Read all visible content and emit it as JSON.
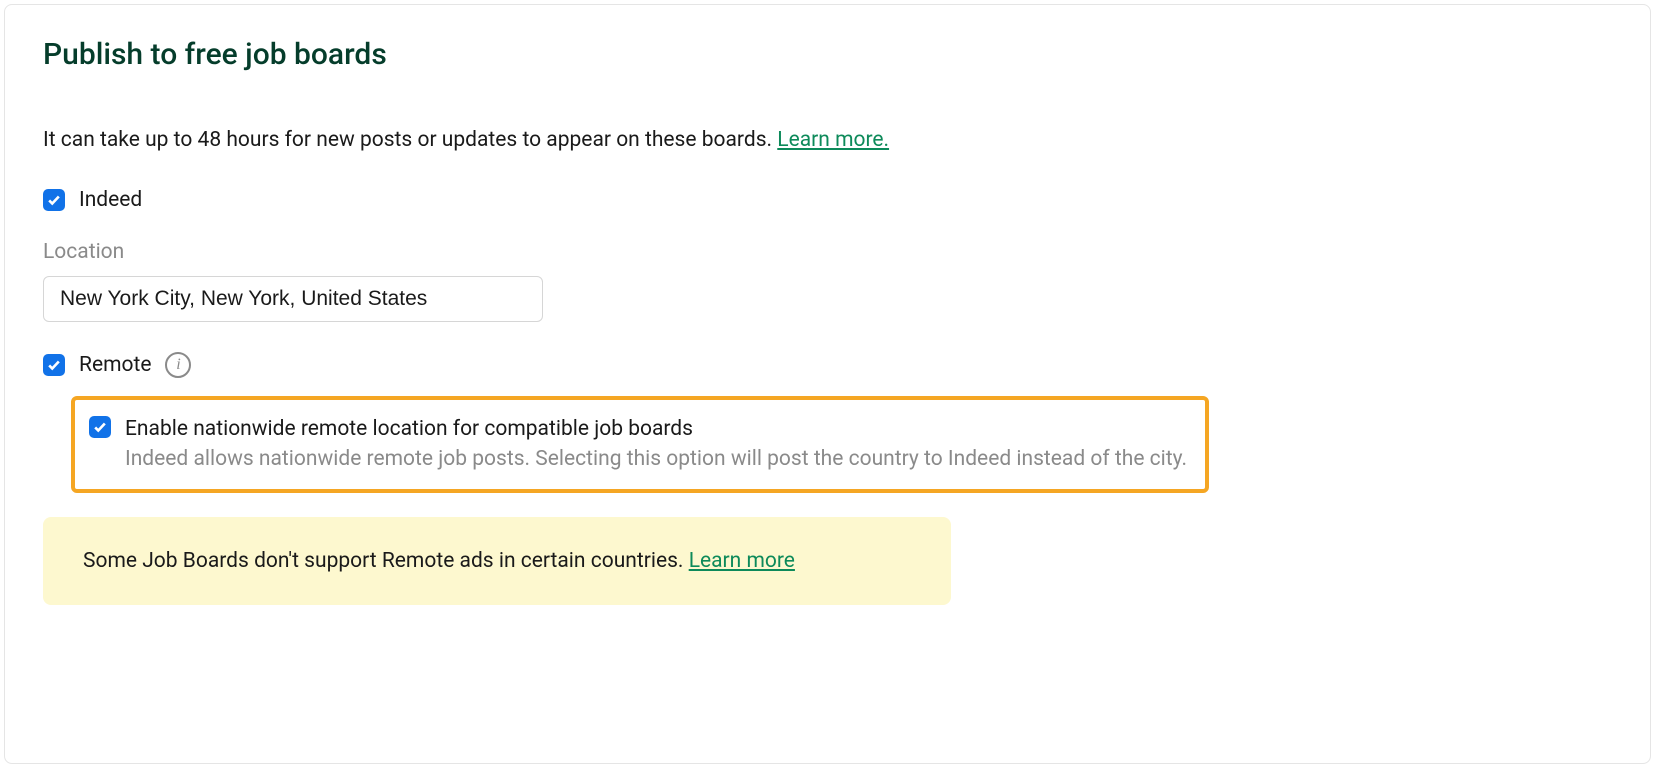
{
  "title": "Publish to free job boards",
  "intro_text": "It can take up to 48 hours for new posts or updates to appear on these boards.  ",
  "intro_link": "Learn more.",
  "indeed": {
    "label": "Indeed",
    "checked": true
  },
  "location": {
    "label": "Location",
    "value": "New York City, New York, United States"
  },
  "remote": {
    "label": "Remote",
    "checked": true
  },
  "nationwide": {
    "checked": true,
    "label": "Enable nationwide remote location for compatible job boards",
    "description": "Indeed allows nationwide remote job posts. Selecting this option will post the country to Indeed instead of the city."
  },
  "note": {
    "text": "Some Job Boards don't support Remote ads in certain countries. ",
    "link": "Learn more"
  }
}
